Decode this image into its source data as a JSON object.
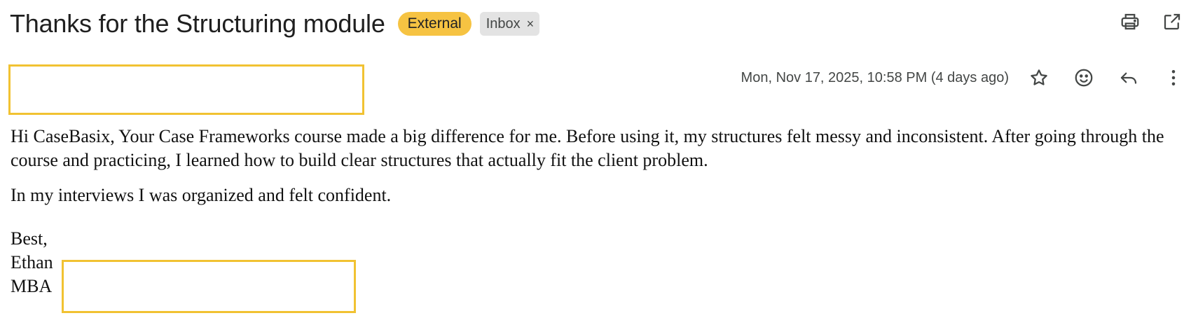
{
  "email": {
    "subject": "Thanks for the Structuring module",
    "labels": {
      "external": "External",
      "inbox": "Inbox",
      "inbox_remove": "×"
    },
    "date": "Mon, Nov 17, 2025, 10:58 PM (4 days ago)",
    "body": {
      "paragraph1": "Hi CaseBasix, Your Case Frameworks course made a big difference for me. Before using it, my structures felt messy and inconsistent. After going through the course and practicing, I learned how to build clear structures that actually fit the client problem.",
      "paragraph2": "In my interviews I was organized and felt confident.",
      "closing": "Best,",
      "name": "Ethan",
      "program": "MBA"
    }
  },
  "colors": {
    "external_label": "#f6c342",
    "inbox_label": "#e3e3e3",
    "redaction_border": "#f1c232"
  },
  "icons": {
    "top": [
      "print-icon",
      "open-in-new-window-icon"
    ],
    "meta": [
      "star-icon",
      "emoji-reaction-icon",
      "reply-icon",
      "more-options-icon"
    ]
  }
}
